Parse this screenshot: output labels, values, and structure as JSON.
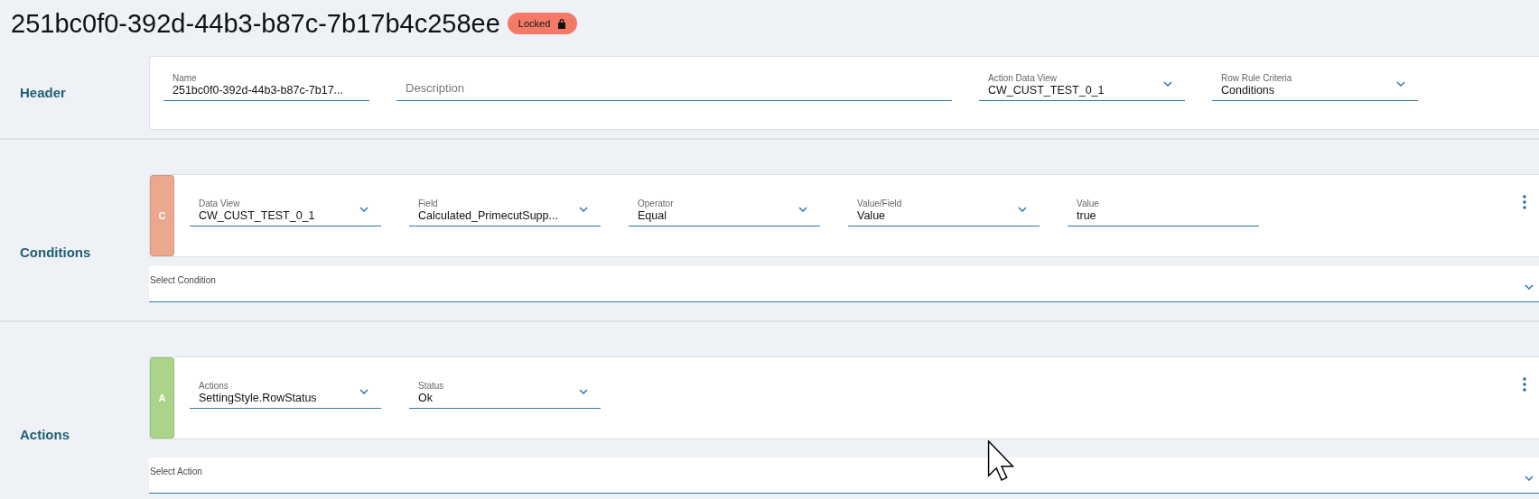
{
  "title": "251bc0f0-392d-44b3-b87c-7b17b4c258ee",
  "badge": {
    "label": "Locked",
    "locked": true
  },
  "sections": [
    {
      "kind": "header",
      "label": "Header",
      "fields": [
        {
          "kind": "text",
          "label": "Name",
          "value": "251bc0f0-392d-44b3-b87c-7b17..."
        },
        {
          "kind": "text",
          "placeholder": "Description"
        },
        {
          "kind": "dropdown",
          "label": "Action Data View",
          "value": "CW_CUST_TEST_0_1"
        },
        {
          "kind": "dropdown",
          "label": "Row Rule Criteria",
          "value": "Conditions"
        }
      ]
    },
    {
      "kind": "rules",
      "label": "Conditions",
      "rows": [
        {
          "tag": "C",
          "color": "#eaa88e",
          "fields": [
            {
              "kind": "dropdown",
              "label": "Data View",
              "value": "CW_CUST_TEST_0_1"
            },
            {
              "kind": "dropdown",
              "label": "Field",
              "value": "Calculated_PrimecutSupp..."
            },
            {
              "kind": "dropdown",
              "label": "Operator",
              "value": "Equal"
            },
            {
              "kind": "dropdown",
              "label": "Value/Field",
              "value": "Value"
            },
            {
              "kind": "text",
              "label": "Value",
              "value": "true"
            }
          ]
        }
      ],
      "select": {
        "label": "Select Condition"
      }
    },
    {
      "kind": "rules",
      "label": "Actions",
      "rows": [
        {
          "tag": "A",
          "color": "#a9d48a",
          "fields": [
            {
              "kind": "dropdown",
              "label": "Actions",
              "value": "SettingStyle.RowStatus"
            },
            {
              "kind": "dropdown",
              "label": "Status",
              "value": "Ok"
            }
          ]
        }
      ],
      "select": {
        "label": "Select Action"
      }
    }
  ]
}
